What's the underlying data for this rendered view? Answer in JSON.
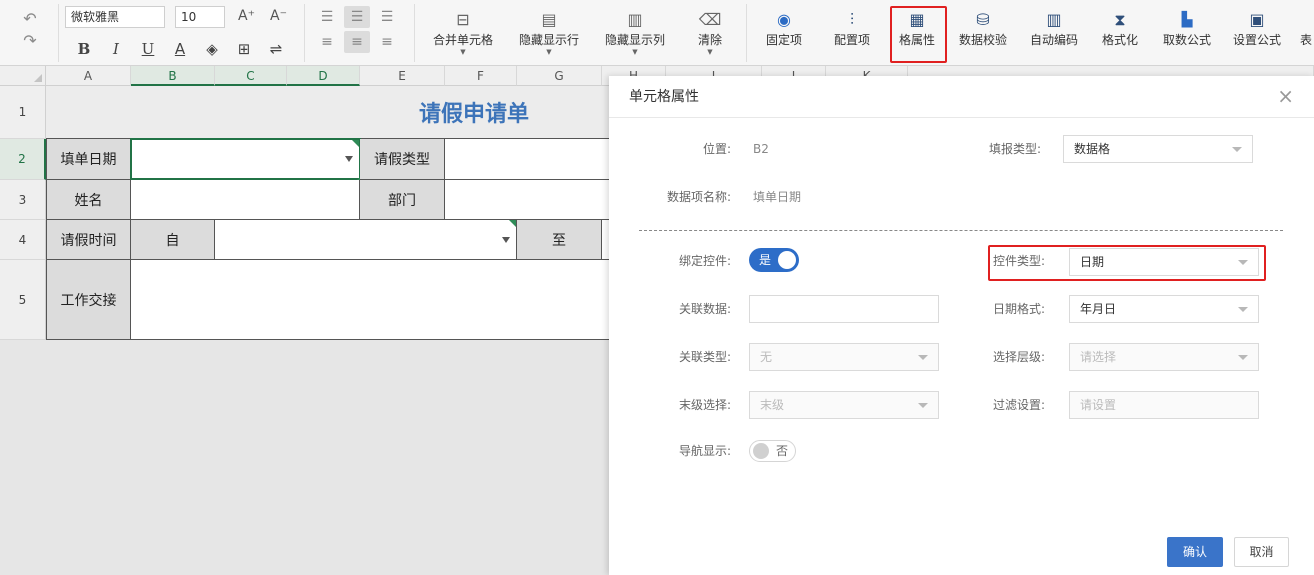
{
  "toolbar": {
    "font_name": "微软雅黑",
    "font_size": "10",
    "grow_font": "A⁺",
    "shrink_font": "A⁻",
    "format": {
      "bold": "B",
      "italic": "I",
      "underline": "U",
      "font_color": "A",
      "fill": "◈",
      "border": "⊞",
      "wrap": "⇌"
    },
    "tools": [
      {
        "id": "merge",
        "label": "合并单元格",
        "icon": "merge-cells-icon",
        "glyph": "⊟"
      },
      {
        "id": "hide-row",
        "label": "隐藏显示行",
        "icon": "hide-rows-icon",
        "glyph": "▤"
      },
      {
        "id": "hide-col",
        "label": "隐藏显示列",
        "icon": "hide-columns-icon",
        "glyph": "▥"
      },
      {
        "id": "clear",
        "label": "清除",
        "icon": "eraser-icon",
        "glyph": "⌫"
      },
      {
        "id": "freeze",
        "label": "固定项",
        "icon": "freeze-icon",
        "glyph": "◉"
      },
      {
        "id": "config",
        "label": "配置项",
        "icon": "sliders-icon",
        "glyph": "⫶"
      },
      {
        "id": "cell-attr",
        "label": "格属性",
        "icon": "grid-attr-icon",
        "glyph": "▦"
      },
      {
        "id": "validate",
        "label": "数据校验",
        "icon": "database-check-icon",
        "glyph": "⛁"
      },
      {
        "id": "auto-code",
        "label": "自动编码",
        "icon": "barcode-icon",
        "glyph": "▥"
      },
      {
        "id": "formatting",
        "label": "格式化",
        "icon": "hourglass-icon",
        "glyph": "⧗"
      },
      {
        "id": "fetch-formula",
        "label": "取数公式",
        "icon": "book-icon",
        "glyph": "📘"
      },
      {
        "id": "set-formula",
        "label": "设置公式",
        "icon": "formula-sheet-icon",
        "glyph": "▣"
      },
      {
        "id": "more",
        "label": "表",
        "icon": "table-icon",
        "glyph": ""
      }
    ]
  },
  "sheet": {
    "columns": [
      "A",
      "B",
      "C",
      "D",
      "E",
      "F",
      "G",
      "H",
      "I",
      "J",
      "K"
    ],
    "rows": [
      "1",
      "2",
      "3",
      "4",
      "5"
    ],
    "title": "请假申请单",
    "cells": {
      "fill_date": "填单日期",
      "leave_type": "请假类型",
      "name": "姓名",
      "dept": "部门",
      "leave_time": "请假时间",
      "from": "自",
      "to": "至",
      "handover": "工作交接"
    }
  },
  "dialog": {
    "title": "单元格属性",
    "close": "×",
    "position_label": "位置:",
    "position_value": "B2",
    "fill_type_label": "填报类型:",
    "fill_type_value": "数据格",
    "data_item_label": "数据项名称:",
    "data_item_value": "填单日期",
    "bind_label": "绑定控件:",
    "bind_value": "是",
    "control_type_label": "控件类型:",
    "control_type_value": "日期",
    "related_data_label": "关联数据:",
    "related_data_value": "",
    "date_format_label": "日期格式:",
    "date_format_value": "年月日",
    "related_type_label": "关联类型:",
    "related_type_value": "无",
    "select_level_label": "选择层级:",
    "select_level_placeholder": "请选择",
    "last_level_label": "末级选择:",
    "last_level_value": "末级",
    "filter_label": "过滤设置:",
    "filter_placeholder": "请设置",
    "nav_label": "导航显示:",
    "nav_value": "否",
    "ok": "确认",
    "cancel": "取消"
  },
  "colors": {
    "accent_blue": "#2d6dc8",
    "highlight_red": "#e02020",
    "selection_green": "#217346",
    "title_blue": "#3d74b9"
  }
}
